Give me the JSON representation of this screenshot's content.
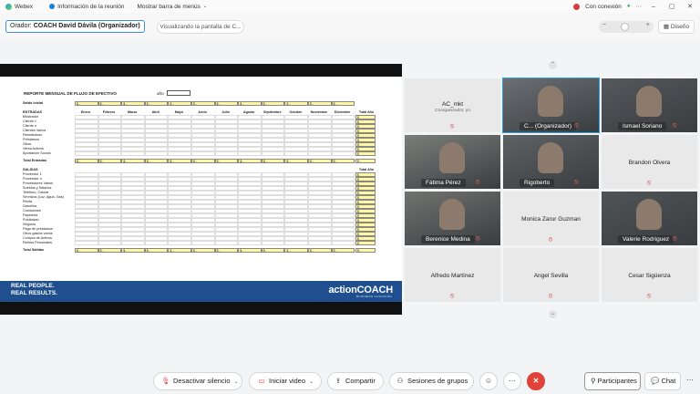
{
  "titlebar": {
    "app": "Webex",
    "meeting_info": "Información de la reunión",
    "menu_bar": "Mostrar barra de menús",
    "connection": "Con conexión"
  },
  "subbar": {
    "speaker_prefix": "Orador:",
    "speaker_name": "COACH David Dávila (Organizador)",
    "sharing": "Visualizando la pantalla de C...",
    "layout": "Diseño"
  },
  "document": {
    "title": "REPORTE MENSUAL DE FLUJO DE EFECTIVO",
    "year_label": "año",
    "saldo_label": "Saldo Inicial",
    "entradas_label": "ENTRADAS",
    "months": [
      "Enero",
      "Febrero",
      "Marzo",
      "Abril",
      "Mayo",
      "Junio",
      "Julio",
      "Agosto",
      "Septiembre",
      "Octubre",
      "Noviembre",
      "Diciembre"
    ],
    "total_year": "Total Año",
    "entradas_rows": [
      "Mostrador",
      "Cliente 1",
      "Cliente n",
      "Clientes Varios",
      "Reembolsos",
      "Préstamos",
      "Otros",
      "Venta Activos",
      "Aportación Socios"
    ],
    "total_entradas": "Total Entradas",
    "salidas_label": "SALIDAS",
    "salidas_rows": [
      "Proveedor 1",
      "Proveedor n",
      "Proveedores Varios",
      "Sueldos y Salarios",
      "Teléfono, Celular",
      "Servicios (Luz, Agua, Gas)",
      "Renta",
      "Gasolina",
      "Comisiones",
      "Papelería",
      "Publicidad",
      "Seguros",
      "Pago de préstamos",
      "Otros gastos varios",
      "Compra de Activos",
      "Retiros Personales"
    ],
    "total_salidas": "Total Salidas",
    "cell_text": "$    -",
    "dollar": "$",
    "footer_left_1": "REAL PEOPLE.",
    "footer_left_2": "REAL RESULTS.",
    "footer_brand": "actionCOACH",
    "footer_brand_sub": "BUSINESS COACHING"
  },
  "participants": [
    {
      "name": "AC_mkt",
      "sub": "Coorganizador, yo",
      "video": false
    },
    {
      "name": "C... (Organizador)",
      "video": true,
      "active": true
    },
    {
      "name": "Ismael Soriano",
      "video": true
    },
    {
      "name": "Fátima Pérez",
      "video": true
    },
    {
      "name": "Rigoberto",
      "video": true
    },
    {
      "name": "Brandon Olvera",
      "video": false
    },
    {
      "name": "Berenice Medina",
      "video": true
    },
    {
      "name": "Monica Zarur Guzman",
      "video": false
    },
    {
      "name": "Valerie Rodriguez",
      "video": true
    },
    {
      "name": "Alfredo Martínez",
      "video": false
    },
    {
      "name": "Angel Sevilla",
      "video": false
    },
    {
      "name": "Cesar Sigüenza",
      "video": false
    }
  ],
  "controls": {
    "mute": "Desactivar silencio",
    "video": "Iniciar video",
    "share": "Compartir",
    "groups": "Sesiones de grupos",
    "participants": "Participantes",
    "chat": "Chat"
  },
  "colors": {
    "accent": "#2aa0e8",
    "end_call": "#e0433a",
    "muted_icon": "#d23c3c",
    "doc_footer": "#1f4f8f",
    "cell_yellow": "#fff7a1"
  }
}
